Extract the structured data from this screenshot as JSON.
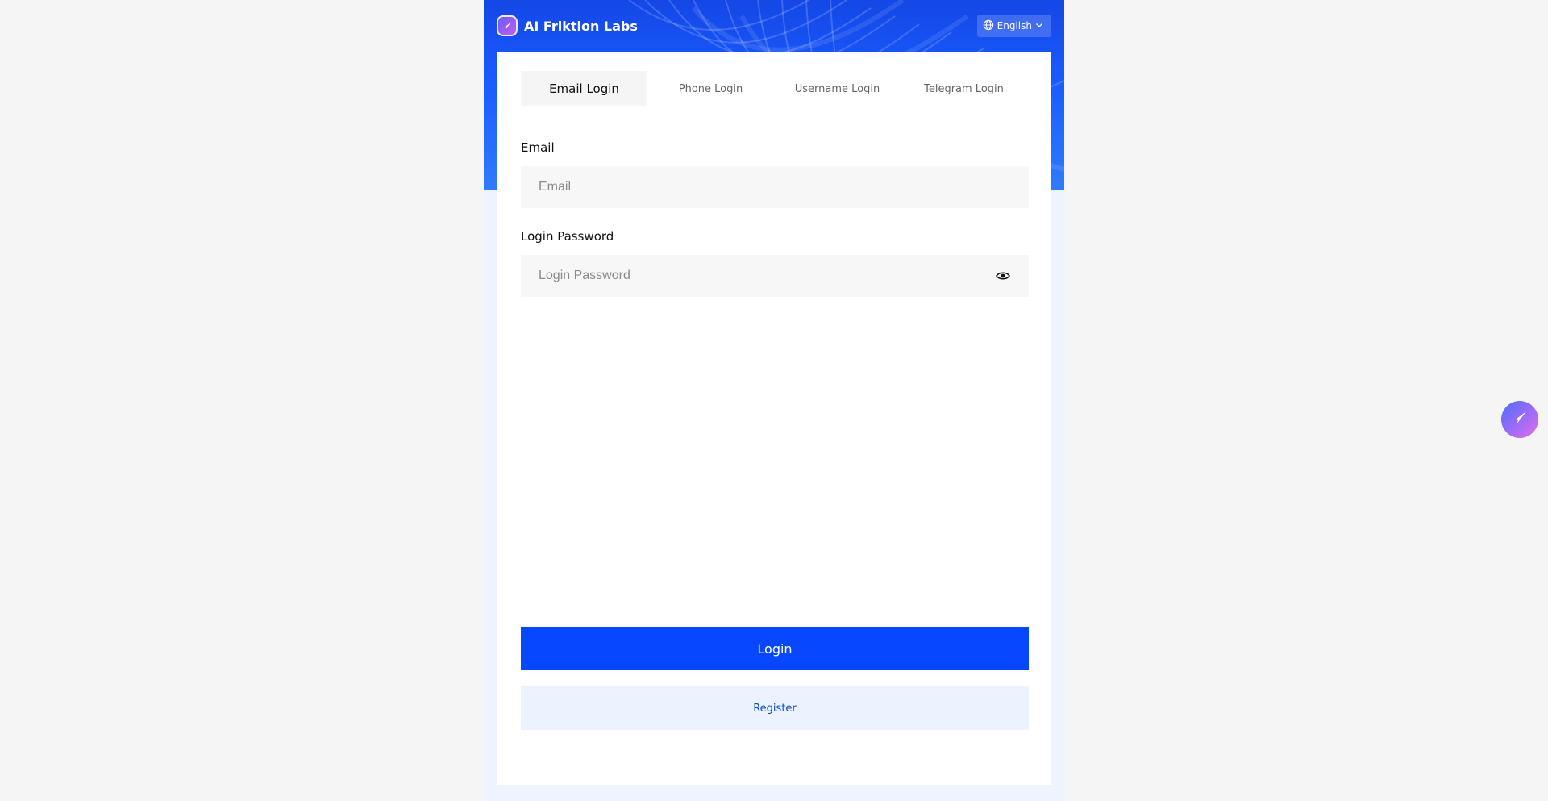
{
  "header": {
    "brand_name": "AI Friktion Labs",
    "brand_icon": "rocket-icon",
    "language": "English"
  },
  "tabs": [
    {
      "label": "Email Login",
      "active": true
    },
    {
      "label": "Phone Login",
      "active": false
    },
    {
      "label": "Username Login",
      "active": false
    },
    {
      "label": "Telegram Login",
      "active": false
    }
  ],
  "form": {
    "email_label": "Email",
    "email_placeholder": "Email",
    "email_value": "",
    "password_label": "Login Password",
    "password_placeholder": "Login Password",
    "password_value": ""
  },
  "actions": {
    "login_label": "Login",
    "register_label": "Register"
  },
  "colors": {
    "primary": "#0647ff",
    "header_blue": "#1a5cff",
    "register_bg": "#edf3fe",
    "register_text": "#0a4fcf"
  },
  "floating_button": {
    "icon": "rocket-icon"
  }
}
